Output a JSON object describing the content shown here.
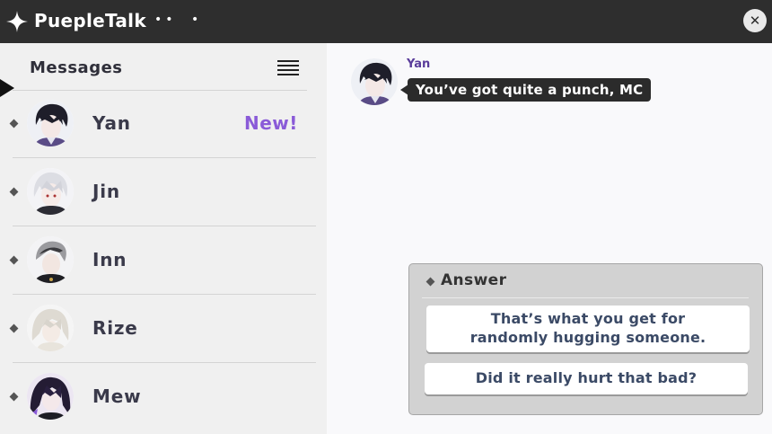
{
  "app": {
    "title": "PuepleTalk",
    "dots": "••",
    "dot_single": "•",
    "close_symbol": "✕"
  },
  "sidebar": {
    "header": "Messages",
    "menu_icon": "hamburger-menu-icon",
    "contacts": [
      {
        "name": "Yan",
        "badge": "New!",
        "selected": true
      },
      {
        "name": "Jin",
        "badge": ""
      },
      {
        "name": "Inn",
        "badge": ""
      },
      {
        "name": "Rize",
        "badge": ""
      },
      {
        "name": "Mew",
        "badge": ""
      }
    ]
  },
  "chat": {
    "sender": "Yan",
    "message": "You’ve got quite a punch, MC"
  },
  "answer": {
    "title": "Answer",
    "options": [
      "That’s what you get for randomly hugging someone.",
      "Did it really hurt that bad?"
    ]
  },
  "colors": {
    "titlebar": "#2e2e2e",
    "badge": "#8a5bd8",
    "sender": "#5a3c9a",
    "bubble": "#2b2b2b"
  }
}
